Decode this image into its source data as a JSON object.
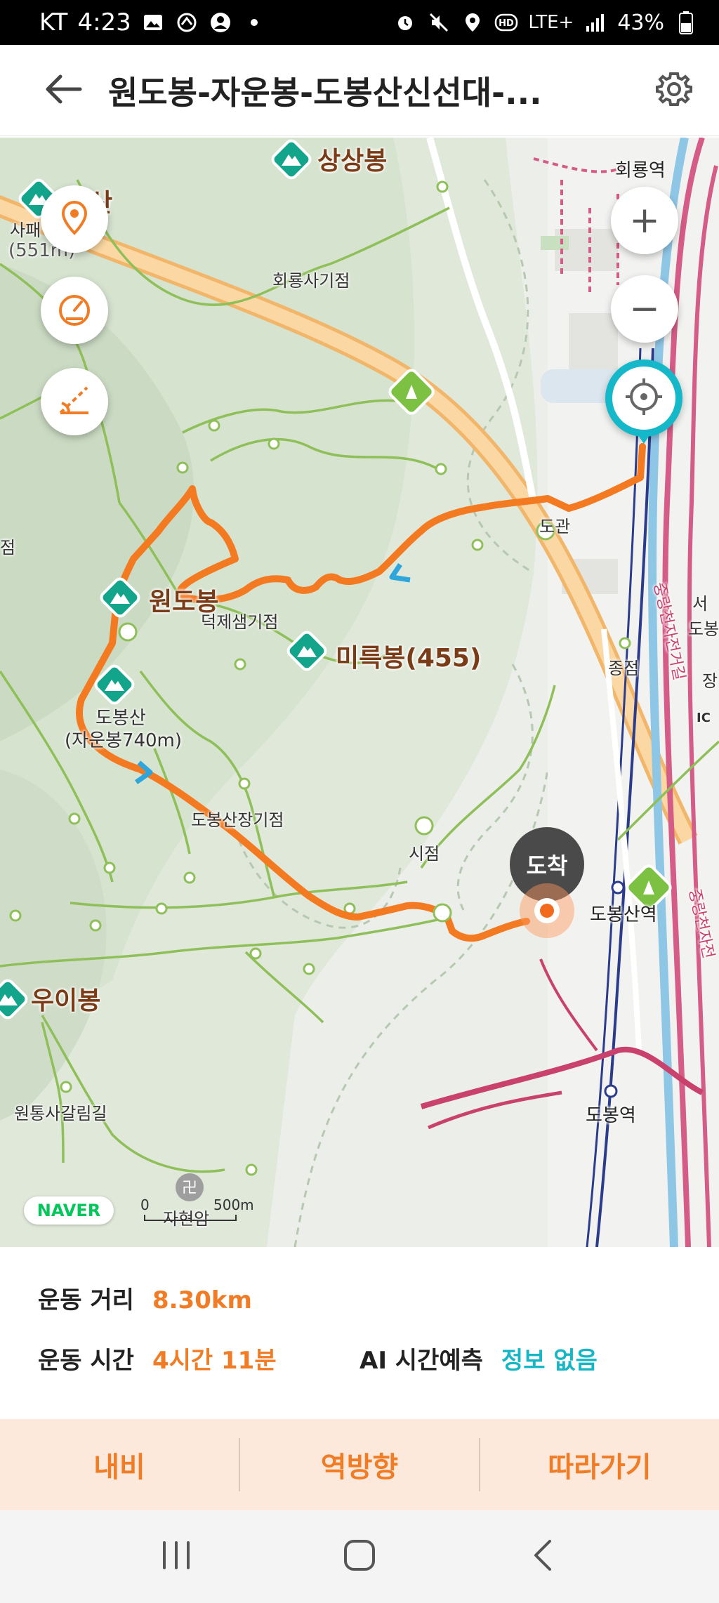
{
  "status_bar": {
    "carrier": "KT",
    "time": "4:23",
    "network": "LTE+",
    "battery": "43%",
    "icons": [
      "image-icon",
      "shoe-icon",
      "account-icon",
      "dot-icon",
      "alarm-icon",
      "mute-icon",
      "location-icon",
      "hd-icon",
      "signal-icon",
      "battery-icon"
    ]
  },
  "header": {
    "title": "원도봉-자운봉-도봉산신선대-...",
    "back_icon": "back-arrow-icon",
    "settings_icon": "gear-icon"
  },
  "map": {
    "peaks": [
      {
        "name": "상상봉"
      },
      {
        "name": "사패산",
        "display": "재산"
      },
      {
        "name": "원도봉"
      },
      {
        "name": "미륵봉(455)"
      },
      {
        "name": "도봉산"
      },
      {
        "name": "우이봉"
      }
    ],
    "labels": {
      "sapae_sub": "사패",
      "sapae_height": "(551m)",
      "dobong_sub": "(자운봉740m)",
      "doksaem": "덕제샘기점",
      "hoeryongsa": "회룡사기점",
      "dobongsanjang": "도봉산장기점",
      "sijeom": "시점",
      "jongjeom": "종점",
      "wontong": "원통사갈림길",
      "jahyeonam": "자현암",
      "hoeryong_station": "회룡역",
      "dobongsan_station": "도봉산역",
      "dobong_station": "도봉역",
      "ic": "IC",
      "road_right": "중랑천자전거길",
      "road_right2": "중랑천자전",
      "seo": "서",
      "do": "도봉",
      "jang": "장",
      "jeom": "점",
      "hoegwan": "도관"
    },
    "arrival_label": "도착",
    "naver_logo": "NAVER",
    "scale": {
      "start": "0",
      "end": "500m"
    },
    "controls": [
      "location-pin-icon",
      "speedometer-icon",
      "slope-icon"
    ],
    "zoom_in": "+",
    "zoom_out": "−",
    "locate_icon": "crosshair-icon",
    "route_color": "#f47a21"
  },
  "info": {
    "distance_label": "운동 거리",
    "distance_value": "8.30km",
    "time_label": "운동 시간",
    "time_value": "4시간 11분",
    "ai_label": "AI 시간예측",
    "ai_value": "정보 없음"
  },
  "actions": {
    "navi": "내비",
    "reverse": "역방향",
    "follow": "따라가기"
  },
  "nav_bar": [
    "recent-apps-icon",
    "home-icon",
    "back-icon"
  ]
}
